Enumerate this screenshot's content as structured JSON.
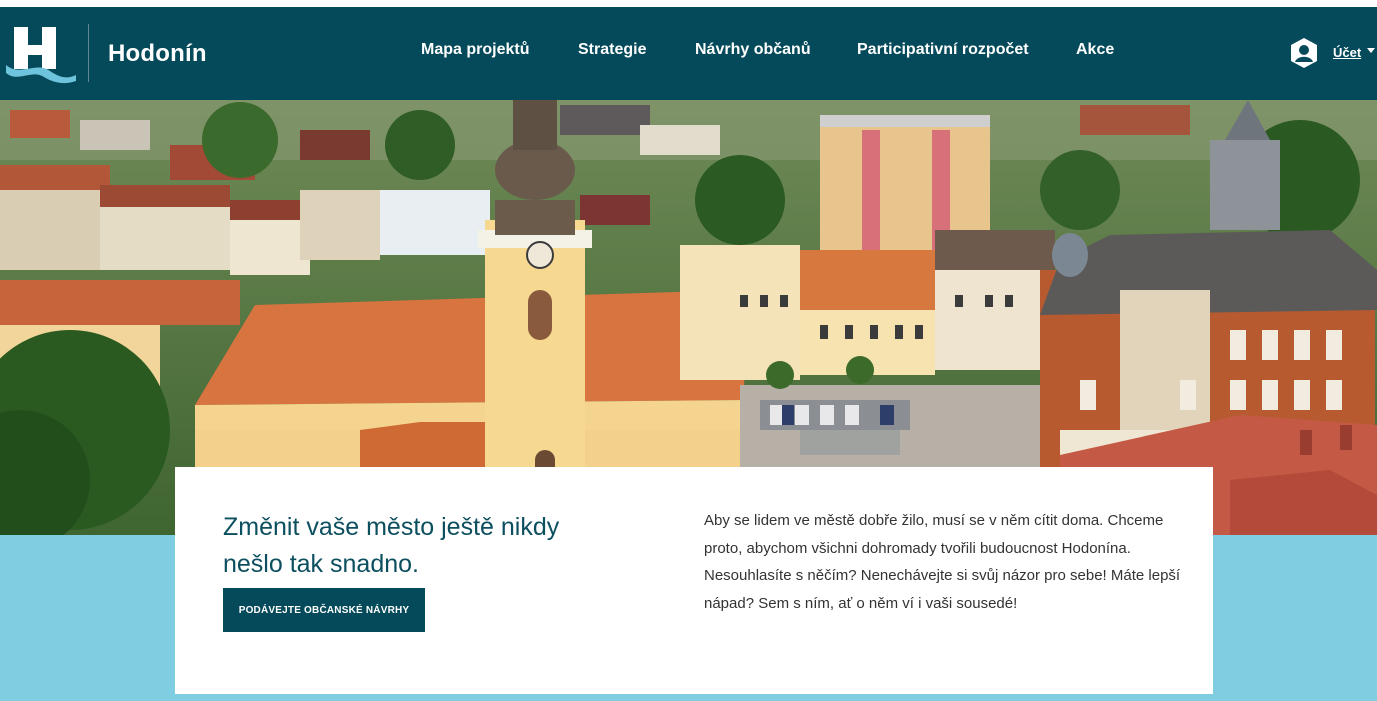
{
  "header": {
    "brand": "Hodonín",
    "nav": [
      {
        "label": "Mapa projektů"
      },
      {
        "label": "Strategie"
      },
      {
        "label": "Návrhy občanů"
      },
      {
        "label": "Participativní rozpočet"
      },
      {
        "label": "Akce"
      }
    ],
    "account_label": "Účet"
  },
  "hero": {
    "headline": "Změnit vaše město ještě nikdy nešlo tak snadno.",
    "cta_label": "PODÁVEJTE OBČANSKÉ NÁVRHY",
    "description": "Aby se lidem ve městě dobře žilo, musí se v něm cítit doma. Chceme proto, abychom všichni dohromady tvořili budoucnost Hodonína. Nesouhlasíte s něčím? Nenechávejte si svůj názor pro sebe! Máte lepší nápad? Sem s ním, ať o něm ví i vaši sousedé!"
  },
  "colors": {
    "header_bg": "#054a5a",
    "band_bg": "#7ecde0",
    "headline": "#0c4f5f",
    "logo_wave": "#6fc4dd"
  },
  "icons": [
    "hodonin-logo-icon",
    "account-icon",
    "chevron-down-icon"
  ]
}
